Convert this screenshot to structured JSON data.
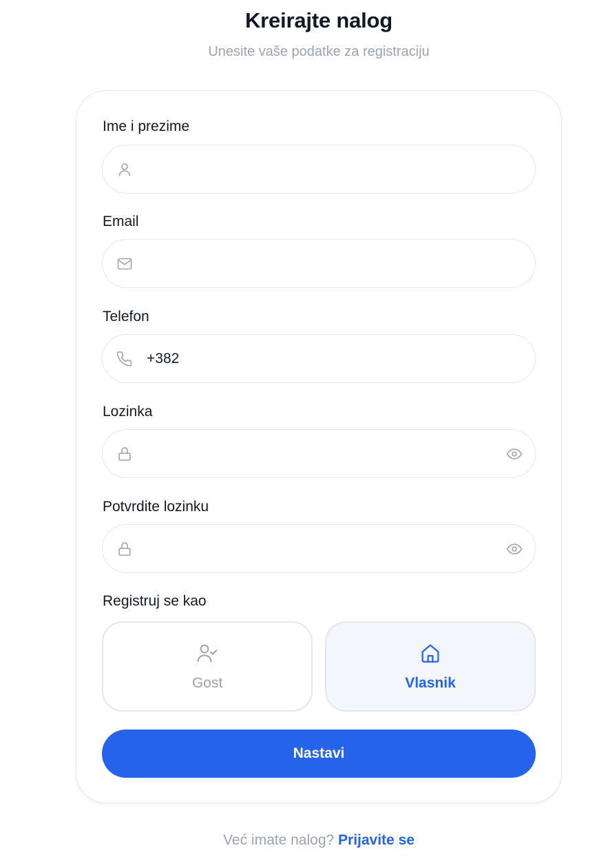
{
  "header": {
    "title": "Kreirajte nalog",
    "subtitle": "Unesite vaše podatke za registraciju"
  },
  "form": {
    "full_name": {
      "label": "Ime i prezime",
      "value": "",
      "icon": "user-icon"
    },
    "email": {
      "label": "Email",
      "value": "",
      "icon": "mail-icon"
    },
    "phone": {
      "label": "Telefon",
      "value": "+382",
      "icon": "phone-icon"
    },
    "password": {
      "label": "Lozinka",
      "value": "",
      "icon": "lock-icon",
      "toggle_icon": "eye-icon"
    },
    "confirm_password": {
      "label": "Potvrdite lozinku",
      "value": "",
      "icon": "lock-icon",
      "toggle_icon": "eye-icon"
    },
    "role": {
      "label": "Registruj se kao",
      "options": [
        {
          "label": "Gost",
          "icon": "user-check-icon",
          "selected": false
        },
        {
          "label": "Vlasnik",
          "icon": "home-icon",
          "selected": true
        }
      ]
    },
    "submit_label": "Nastavi"
  },
  "footer": {
    "prompt": "Već imate nalog?",
    "link_label": "Prijavite se"
  },
  "colors": {
    "primary": "#2563eb",
    "muted_text": "#9ca3af",
    "border": "#e5e7eb",
    "selected_bg": "#f3f6fc",
    "text": "#111827"
  }
}
